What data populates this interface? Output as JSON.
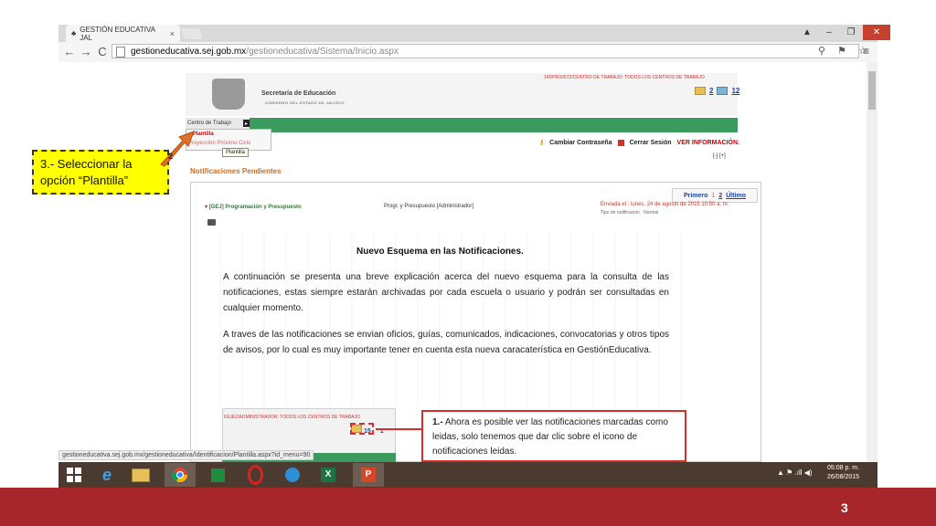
{
  "browser": {
    "tab_title": "GESTIÓN EDUCATIVA JAL",
    "tab_close": "×",
    "window_controls": [
      "▲",
      "–",
      "❐",
      "✕"
    ],
    "nav": {
      "back": "←",
      "forward": "→",
      "reload": "C"
    },
    "url_host": "gestioneducativa.sej.gob.mx",
    "url_path": "/gestioneducativa/Sistema/Inicio.aspx",
    "toolbar_icons": "⚲ ⚑ ☆",
    "menu_icon": "≡",
    "status_url": "gestioneducativa.sej.gob.mx/gestioneducativa/Identificacion/Plantilla.aspx?id_menu=90"
  },
  "site": {
    "org_title": "Secretaría de Educación",
    "org_sub": "GOBIERNO DEL ESTADO DE JALISCO",
    "user_line": "14DPR3267Z/CENTRO DE TRABAJO: TODOS LOS CENTROS DE TRABAJO",
    "counter_a": "2",
    "counter_b": "12",
    "menu_label": "Centro de Trabajo",
    "menu_arrow": "▸",
    "dropdown_item1": "Plantilla",
    "dropdown_item2": "Proyección Próximo Ciclo",
    "tooltip": "Plantilla",
    "change_password": "Cambiar Contraseña",
    "logout": "Cerrar Sesión",
    "view_info": "VER INFORMACIÓN.",
    "collapse": "[-] [+]"
  },
  "notifications": {
    "title": "Notificaciones Pendientes",
    "pager": {
      "first": "Primero",
      "page1": "1",
      "page2": "2",
      "last": "Último"
    },
    "program": "[GEJ] Programación y Presupuesto",
    "admin": "Progr. y Presupuesto [Administrador]",
    "sent": "Enviada el : lunes, 24 de agosto de 2015 10:50 a. m.",
    "type": "Tipo de notificación : Normal",
    "heading": "Nuevo Esquema en las  Notificaciones.",
    "para1": "A continuación se presenta una breve explicación acerca del nuevo esquema para la consulta de las notificaciones, estas siempre estarán archivadas por cada escuela o usuario y podrán ser consultadas en cualquier momento.",
    "para2": "A traves de las notificaciones se envian oficios, guías, comunicados, indicaciones, convocatorias y otros tipos de avisos, por lo cual es muy importante tener en cuenta esta nueva caracaterística en GestiónEducativa.",
    "inset_text": "IGUEZ/ADMINISTRADOR: TODOS LOS CENTROS DE TRABAJO",
    "inset_count_a": "15",
    "inset_count_b": "1",
    "note_num": "1.-",
    "note_text": " Ahora es posible ver las notificaciones marcadas como leidas, solo tenemos que dar clic sobre el icono de notificaciones leidas."
  },
  "callout": {
    "text": "3.- Seleccionar la opción “Plantilla”",
    "arrow_num": "2"
  },
  "taskbar": {
    "apps": [
      "windows",
      "internet-explorer",
      "file-explorer",
      "chrome",
      "store",
      "opera",
      "app-blue",
      "excel",
      "powerpoint"
    ],
    "tray": "▲  ⚑  .ıll  ◀)",
    "time": "05:08 p. m.",
    "date": "26/08/2015"
  },
  "slide": {
    "page_number": "3"
  },
  "colors": {
    "accent_red": "#a6262a",
    "green": "#3b9a5d",
    "callout_yellow": "#ffff00"
  }
}
